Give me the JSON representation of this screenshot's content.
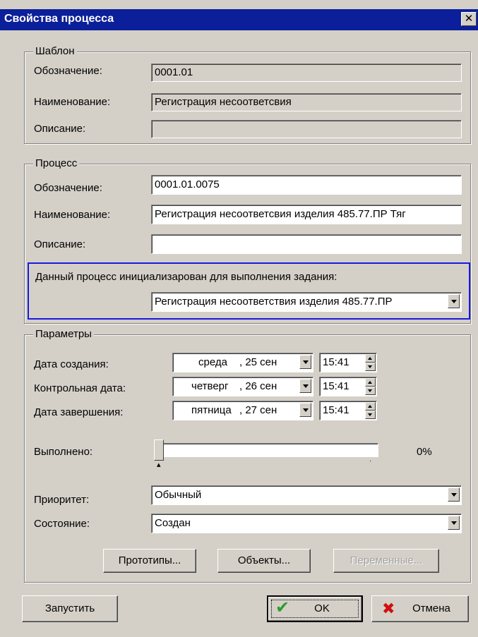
{
  "window": {
    "title": "Свойства процесса",
    "close_label": "✕"
  },
  "template": {
    "legend": "Шаблон",
    "designation_label": "Обозначение:",
    "designation_value": "0001.01",
    "name_label": "Наименование:",
    "name_value": "Регистрация несоответсвия",
    "description_label": "Описание:",
    "description_value": ""
  },
  "process": {
    "legend": "Процесс",
    "designation_label": "Обозначение:",
    "designation_value": "0001.01.0075",
    "name_label": "Наименование:",
    "name_value": "Регистрация несоответсвия изделия 485.77.ПР Тяг",
    "description_label": "Описание:",
    "description_value": "",
    "task_label": "Данный процесс инициализарован для выполнения задания:",
    "task_value": "Регистрация несоответствия изделия 485.77.ПР"
  },
  "params": {
    "legend": "Параметры",
    "created_label": "Дата создания:",
    "created_day": "среда",
    "created_date": ", 25 сен",
    "created_time": "15:41",
    "control_label": "Контрольная дата:",
    "control_day": "четверг",
    "control_date": ", 26 сен",
    "control_time": "15:41",
    "finish_label": "Дата завершения:",
    "finish_day": "пятница",
    "finish_date": ", 27 сен",
    "finish_time": "15:41",
    "done_label": "Выполнено:",
    "done_value": "0%",
    "done_fraction": 0,
    "priority_label": "Приоритет:",
    "priority_value": "Обычный",
    "state_label": "Состояние:",
    "state_value": "Создан",
    "prototypes_button": "Прототипы...",
    "objects_button": "Объекты...",
    "variables_button": "Переменные..."
  },
  "footer": {
    "run_button": "Запустить",
    "ok_button": "OK",
    "cancel_button": "Отмена"
  },
  "colors": {
    "titlebar": "#0b1f9a",
    "highlight_border": "#1a1ae0",
    "ok_check": "#2e9b2e",
    "cancel_x": "#d01010"
  }
}
